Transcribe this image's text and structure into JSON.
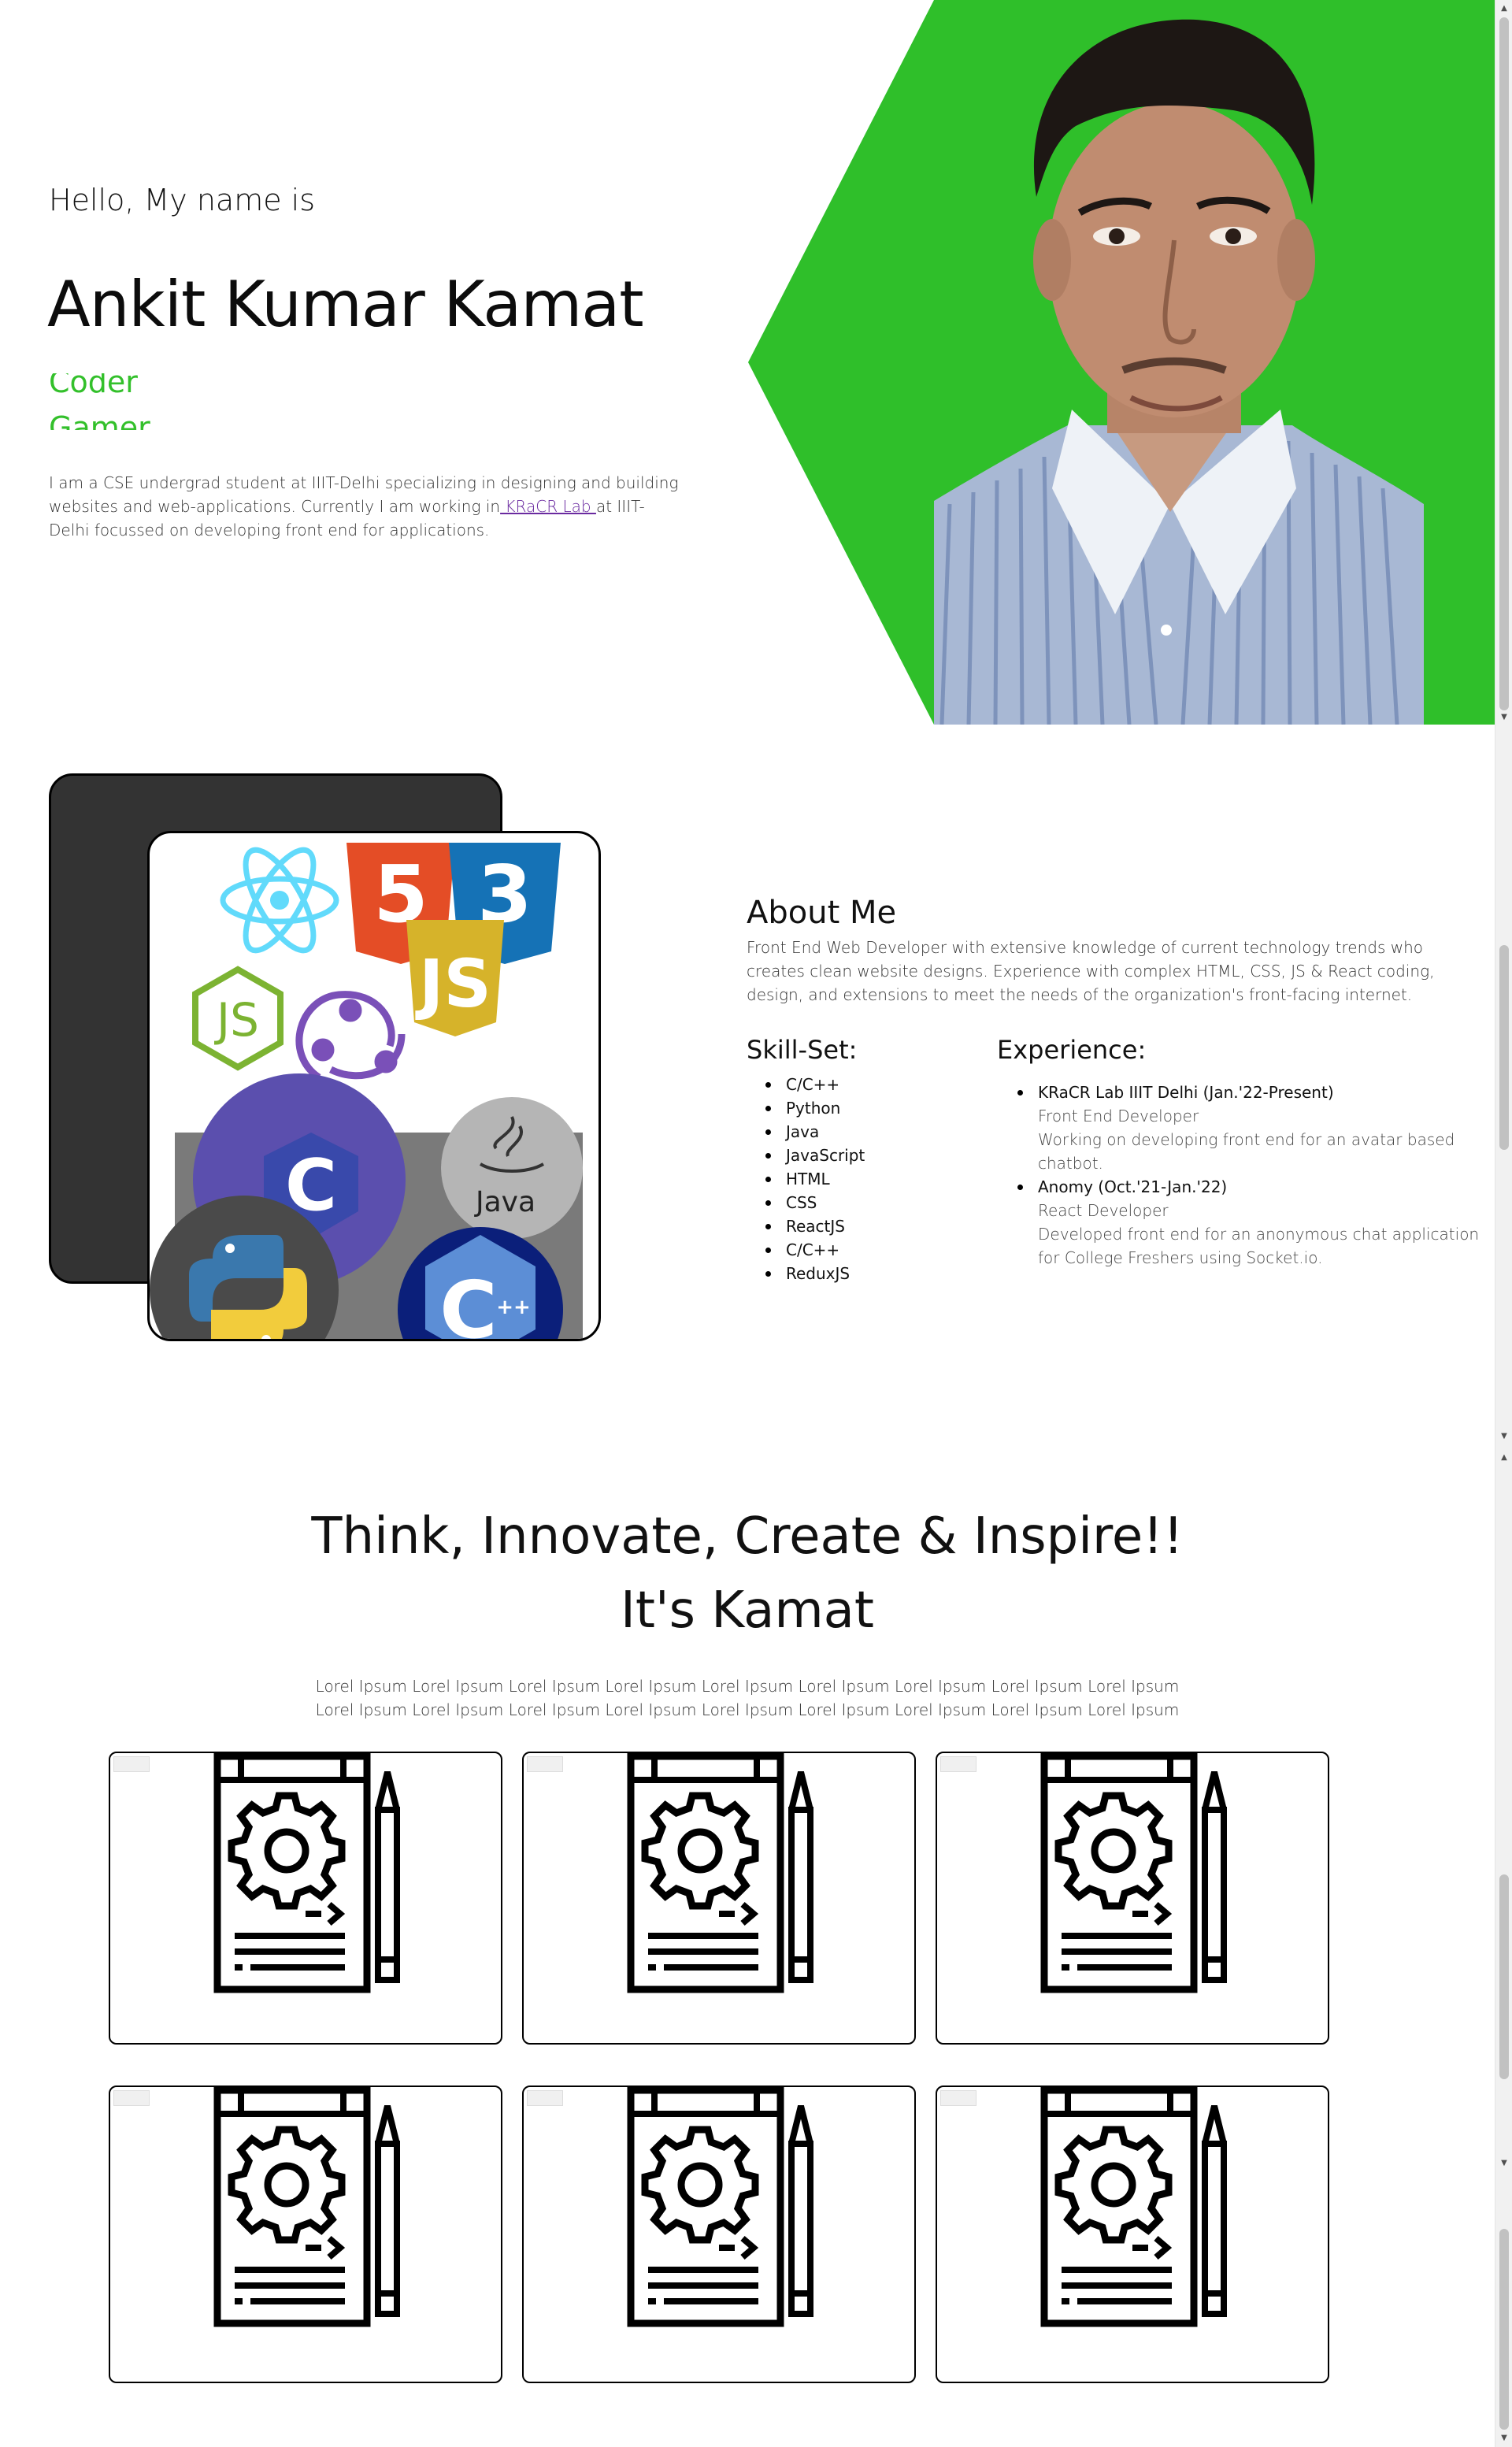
{
  "hero": {
    "greeting": "Hello, My name is",
    "name": "Ankit Kumar Kamat",
    "roles": [
      "Coder",
      "Gamer"
    ],
    "intro_before": "I am a CSE undergrad student at IIIT-Delhi specializing in designing and building websites and web-applications. Currently I am working in",
    "intro_link": " KRaCR Lab ",
    "intro_after": "at IIIT-Delhi focussed on developing front end for applications.",
    "accent_color": "#2fbf2a"
  },
  "about": {
    "title": "About Me",
    "text": "Front End Web Developer with extensive knowledge of current technology trends who creates clean website designs. Experience with complex HTML, CSS, JS & React coding, design, and extensions to meet the needs of the organization's front-facing internet.",
    "skills_title": "Skill-Set:",
    "skills": [
      "C/C++",
      "Python",
      "Java",
      "JavaScript",
      "HTML",
      "CSS",
      "ReactJS",
      "C/C++",
      "ReduxJS"
    ],
    "experience_title": "Experience:",
    "experience": [
      {
        "head": "KRaCR Lab IIIT Delhi (Jan.'22-Present)",
        "role": "Front End Developer",
        "desc": "Working on developing front end for an avatar based chatbot."
      },
      {
        "head": "Anomy (Oct.'21-Jan.'22)",
        "role": "React Developer",
        "desc": "Developed front end for an anonymous chat application for College Freshers using Socket.io."
      }
    ],
    "card_icons": [
      "react-icon",
      "html5-icon",
      "css3-icon",
      "javascript-icon",
      "nodejs-icon",
      "redux-icon",
      "c-icon",
      "java-icon",
      "python-icon",
      "cplusplus-icon"
    ],
    "card_java_label": "Java"
  },
  "think": {
    "line1": "Think, Innovate, Create & Inspire!!",
    "line2": "It's Kamat",
    "text": "Lorel Ipsum Lorel Ipsum Lorel Ipsum Lorel Ipsum Lorel Ipsum Lorel Ipsum Lorel Ipsum Lorel Ipsum Lorel Ipsum Lorel Ipsum Lorel Ipsum Lorel Ipsum Lorel Ipsum Lorel Ipsum Lorel Ipsum Lorel Ipsum Lorel Ipsum Lorel Ipsum",
    "project_icon": "project-settings-icon",
    "project_count": 6
  }
}
